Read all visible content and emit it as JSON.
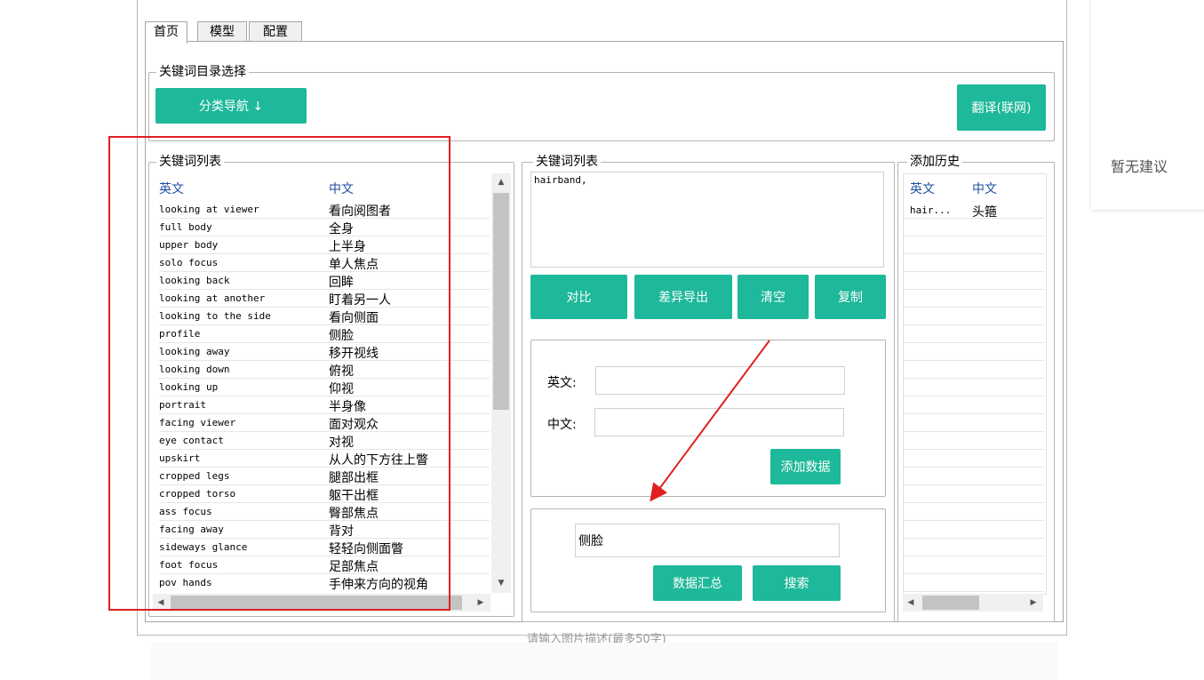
{
  "tabs": [
    {
      "label": "首页",
      "active": true
    },
    {
      "label": "模型",
      "active": false
    },
    {
      "label": "配置",
      "active": false
    }
  ],
  "catalog": {
    "title": "关键词目录选择",
    "nav_button": "分类导航 ↓",
    "translate_button": "翻译(联网)"
  },
  "keyword_list": {
    "title": "关键词列表",
    "col_en": "英文",
    "col_zh": "中文",
    "rows": [
      [
        "looking at viewer",
        "看向阅图者"
      ],
      [
        "full body",
        "全身"
      ],
      [
        "upper body",
        "上半身"
      ],
      [
        "solo focus",
        "单人焦点"
      ],
      [
        "looking back",
        "回眸"
      ],
      [
        "looking at another",
        "盯着另一人"
      ],
      [
        "looking to the side",
        "看向侧面"
      ],
      [
        "profile",
        "侧脸"
      ],
      [
        "looking away",
        "移开视线"
      ],
      [
        "looking down",
        "俯视"
      ],
      [
        "looking up",
        "仰视"
      ],
      [
        "portrait",
        "半身像"
      ],
      [
        "facing viewer",
        "面对观众"
      ],
      [
        "eye contact",
        "对视"
      ],
      [
        "upskirt",
        "从人的下方往上瞥"
      ],
      [
        "cropped legs",
        "腿部出框"
      ],
      [
        "cropped torso",
        "躯干出框"
      ],
      [
        "ass focus",
        "臀部焦点"
      ],
      [
        "facing away",
        "背对"
      ],
      [
        "sideways glance",
        "轻轻向侧面瞥"
      ],
      [
        "foot focus",
        "足部焦点"
      ],
      [
        "pov hands",
        "手伸来方向的视角"
      ]
    ]
  },
  "selected_panel": {
    "title": "关键词列表",
    "content": "hairband,",
    "buttons": {
      "compare": "对比",
      "export_diff": "差异导出",
      "clear": "清空",
      "copy": "复制"
    }
  },
  "add_form": {
    "en_label": "英文:",
    "zh_label": "中文:",
    "en_value": "",
    "zh_value": "",
    "add_button": "添加数据"
  },
  "search": {
    "value": "侧脸",
    "summary_button": "数据汇总",
    "search_button": "搜索"
  },
  "history": {
    "title": "添加历史",
    "col_en": "英文",
    "col_zh": "中文",
    "rows": [
      [
        "hair...",
        "头箍"
      ]
    ]
  },
  "suggestion": "暂无建议",
  "caption": "请输入图片描述(最多50字)",
  "colors": {
    "accent": "#1eb89a",
    "highlight_box": "#e02020",
    "arrow": "#e02020"
  }
}
